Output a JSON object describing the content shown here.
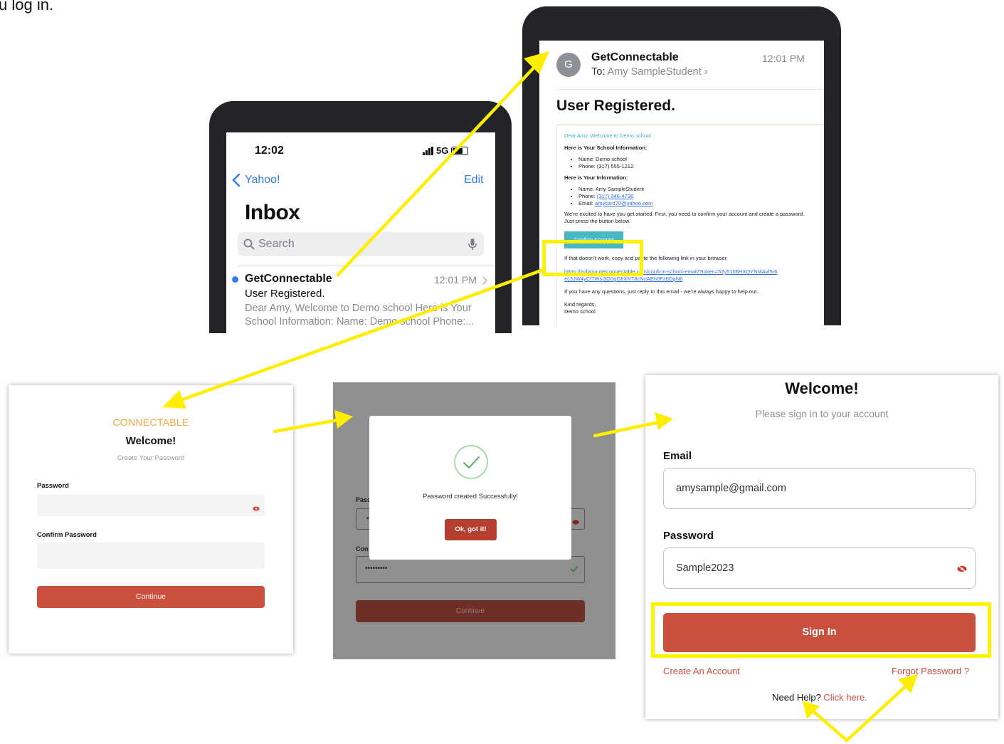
{
  "cropped_text": "u log in.",
  "inbox_phone": {
    "status_time": "12:02",
    "status_network": "5G",
    "back_label": "Yahoo!",
    "edit_label": "Edit",
    "title": "Inbox",
    "search_placeholder": "Search",
    "message": {
      "sender": "GetConnectable",
      "time": "12:01 PM",
      "subject": "User Registered.",
      "preview": "Dear Amy, Welcome to Demo school Here is Your School Information: Name: Demo school Phone:..."
    }
  },
  "email_phone": {
    "avatar_letter": "G",
    "sender": "GetConnectable",
    "time": "12:01 PM",
    "to_label": "To:",
    "to_name": "Amy SampleStudent",
    "subject": "User Registered.",
    "greeting": "Dear Amy, Welcome to Demo school",
    "school_heading": "Here is Your School Information:",
    "school_items": [
      "Name: Demo school",
      "Phone: (317) 555-1212"
    ],
    "info_heading": "Here is Your Information:",
    "info_name": "Name: Amy SampleStudent",
    "info_phone_label": "Phone:",
    "info_phone_value": "(317) 946-4736",
    "info_email_label": "Email:",
    "info_email_value": "amycard70@yahoo.com",
    "body_text": "We're excited to have you get started. First, you need to confirm your account and create a password. Just press the button below.",
    "confirm_button": "Confirm Account",
    "fallback_text": "If that doesn't work, copy and paste the following link in your browser.",
    "link_text": "https://indiana.getconnectable.com/confirm-school-email/?token=52y510$HXQYNt4Avf5r6ec3JW4yCf7Wsi3G0gG8XNT8cNuAEh0Fz6OgN6",
    "help_text": "If you have any questions, just reply to this email - we're always happy to help out.",
    "signoff": "Kind regards,",
    "signoff_name": "Demo school"
  },
  "create_password_panel": {
    "logo": "CONNECTABLE",
    "title": "Welcome!",
    "subtitle": "Create Your Password",
    "password_label": "Password",
    "confirm_label": "Confirm Password",
    "continue_button": "Continue"
  },
  "success_panel": {
    "message": "Password created Successfully!",
    "ok_button": "Ok, got it!",
    "bg_password_label": "Pass",
    "bg_confirm_label": "Con",
    "bg_password_dots": "•",
    "bg_confirm_dots": "•••••••••",
    "bg_continue": "Continue"
  },
  "signin_panel": {
    "title": "Welcome!",
    "subtitle": "Please sign in to your account",
    "email_label": "Email",
    "email_value": "amysample@gmail.com",
    "password_label": "Password",
    "password_value": "Sample2023",
    "signin_button": "Sign In",
    "create_account": "Create An Account",
    "forgot_password": "Forgot Password ?",
    "need_help": "Need Help?",
    "click_here": "Click here."
  },
  "colors": {
    "accent_red": "#c9503d",
    "highlight_yellow": "#fff200",
    "ios_blue": "#2f7bf2",
    "teal": "#4bb6c4",
    "logo_orange": "#f0a73a"
  }
}
